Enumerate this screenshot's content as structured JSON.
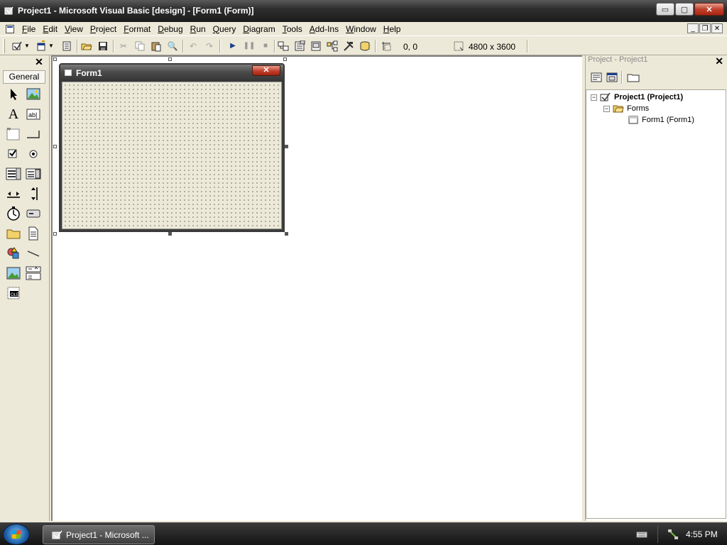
{
  "window": {
    "title": "Project1 - Microsoft Visual Basic [design] - [Form1 (Form)]",
    "minimize_label": "▭",
    "maximize_label": "▢",
    "close_label": "✕"
  },
  "menu": {
    "items": [
      "File",
      "Edit",
      "View",
      "Project",
      "Format",
      "Debug",
      "Run",
      "Query",
      "Diagram",
      "Tools",
      "Add-Ins",
      "Window",
      "Help"
    ]
  },
  "toolbar": {
    "position_readout": "0, 0",
    "size_readout": "4800 x 3600"
  },
  "toolbox": {
    "tab_label": "General",
    "close_label": "✕"
  },
  "form": {
    "title": "Form1",
    "close_label": "✕"
  },
  "project_explorer": {
    "title": "Project - Project1",
    "close_label": "✕",
    "tree": {
      "root": "Project1 (Project1)",
      "folder": "Forms",
      "item": "Form1 (Form1)"
    }
  },
  "taskbar": {
    "task_label": "Project1 - Microsoft ...",
    "clock": "4:55 PM"
  },
  "colors": {
    "chrome": "#ece9d8",
    "title_dark": "#1c1c1c",
    "close_red": "#c0402c"
  }
}
